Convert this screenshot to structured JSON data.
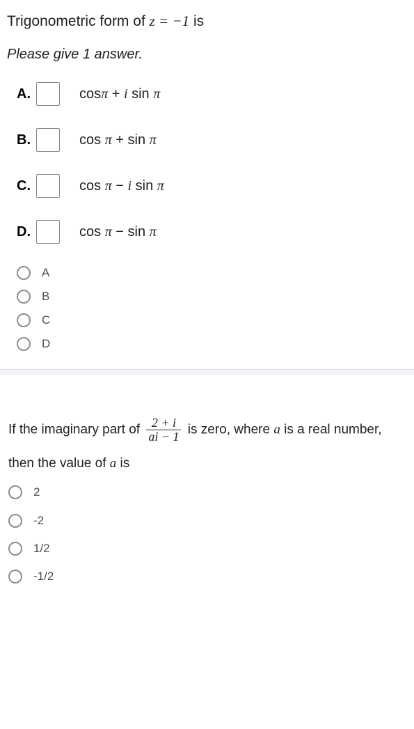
{
  "q1": {
    "title_pre": "Trigonometric  form of ",
    "title_math": "z = −1",
    "title_post": " is",
    "instruction": "Please give 1 answer.",
    "choices": [
      {
        "label": "A.",
        "expr_html": "cos<span class='i'>π</span> + <span class='i'>i</span> sin <span class='i'>π</span>"
      },
      {
        "label": "B.",
        "expr_html": "cos <span class='i'>π</span> + sin <span class='i'>π</span>"
      },
      {
        "label": "C.",
        "expr_html": "cos <span class='i'>π</span> − <span class='i'>i</span> sin <span class='i'>π</span>"
      },
      {
        "label": "D.",
        "expr_html": "cos <span class='i'>π</span> − sin <span class='i'>π</span>"
      }
    ],
    "radios": [
      "A",
      "B",
      "C",
      "D"
    ]
  },
  "q2": {
    "line1_pre": "If the imaginary part of ",
    "frac_num": "2 + i",
    "frac_den": "ai − 1",
    "line1_post": " is zero, where ",
    "var_a": "a",
    "line1_tail": " is a real number,",
    "line2_pre": "then the value of ",
    "line2_post": " is",
    "radios": [
      "2",
      "-2",
      "1/2",
      "-1/2"
    ]
  }
}
